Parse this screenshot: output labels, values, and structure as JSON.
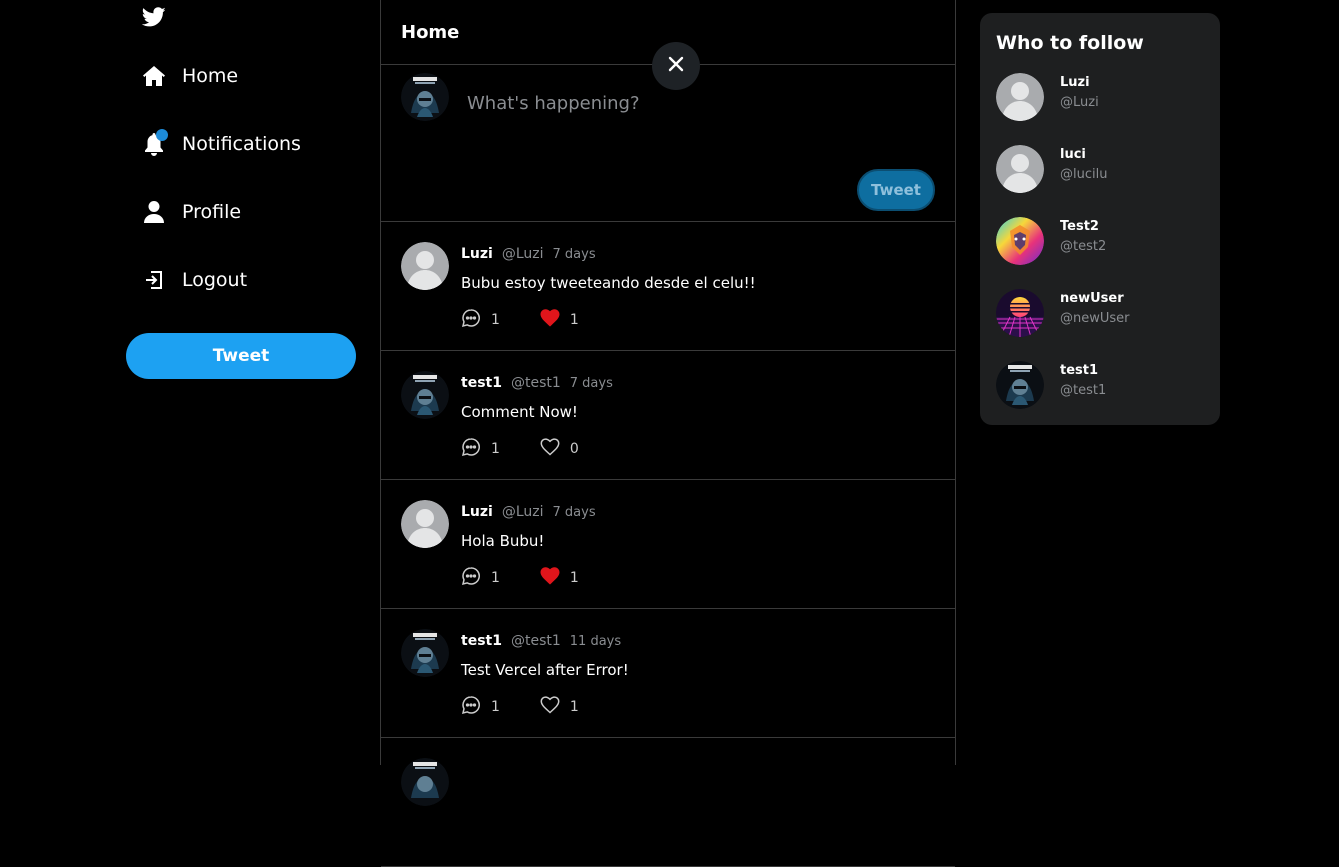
{
  "sidebar": {
    "nav": [
      {
        "label": "Home",
        "icon": "home-icon"
      },
      {
        "label": "Notifications",
        "icon": "bell-icon"
      },
      {
        "label": "Profile",
        "icon": "user-icon"
      },
      {
        "label": "Logout",
        "icon": "logout-icon"
      }
    ],
    "tweet_button": "Tweet"
  },
  "feed": {
    "title": "Home",
    "compose": {
      "placeholder": "What's happening?",
      "tweet_button": "Tweet"
    },
    "tweets": [
      {
        "name": "Luzi",
        "handle": "@Luzi",
        "time": "7 days",
        "text": "Bubu estoy tweeteando desde el celu!!",
        "comments": "1",
        "likes": "1",
        "liked": true,
        "avatar": "default"
      },
      {
        "name": "test1",
        "handle": "@test1",
        "time": "7 days",
        "text": "Comment Now!",
        "comments": "1",
        "likes": "0",
        "liked": false,
        "avatar": "hacker"
      },
      {
        "name": "Luzi",
        "handle": "@Luzi",
        "time": "7 days",
        "text": "Hola Bubu!",
        "comments": "1",
        "likes": "1",
        "liked": true,
        "avatar": "default"
      },
      {
        "name": "test1",
        "handle": "@test1",
        "time": "11 days",
        "text": "Test Vercel after Error!",
        "comments": "1",
        "likes": "1",
        "liked": false,
        "avatar": "hacker"
      }
    ]
  },
  "who_to_follow": {
    "title": "Who to follow",
    "users": [
      {
        "name": "Luzi",
        "handle": "@Luzi",
        "avatar": "default"
      },
      {
        "name": "luci",
        "handle": "@lucilu",
        "avatar": "default"
      },
      {
        "name": "Test2",
        "handle": "@test2",
        "avatar": "lion"
      },
      {
        "name": "newUser",
        "handle": "@newUser",
        "avatar": "synthwave"
      },
      {
        "name": "test1",
        "handle": "@test1",
        "avatar": "hacker"
      }
    ]
  },
  "colors": {
    "accent": "#1da1f2",
    "like_active": "#e0151b",
    "background": "#000000",
    "panel": "#1e1f20",
    "muted_text": "#8a8d91"
  }
}
